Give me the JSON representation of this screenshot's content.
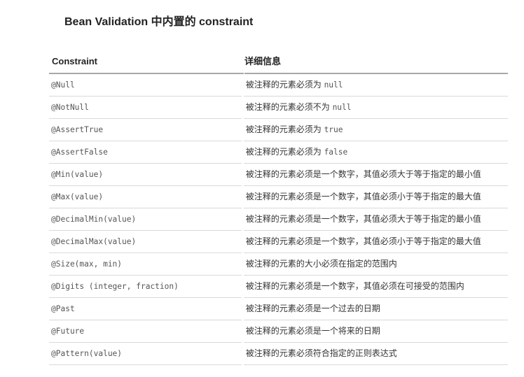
{
  "title": "Bean Validation 中内置的 constraint",
  "table": {
    "headers": [
      "Constraint",
      "详细信息"
    ],
    "rows": [
      {
        "constraint": "@Null",
        "desc": "被注释的元素必须为 ",
        "code": "null",
        "tail": ""
      },
      {
        "constraint": "@NotNull",
        "desc": "被注释的元素必须不为 ",
        "code": "null",
        "tail": ""
      },
      {
        "constraint": "@AssertTrue",
        "desc": "被注释的元素必须为 ",
        "code": "true",
        "tail": ""
      },
      {
        "constraint": "@AssertFalse",
        "desc": "被注释的元素必须为 ",
        "code": "false",
        "tail": ""
      },
      {
        "constraint": "@Min(value)",
        "desc": "被注释的元素必须是一个数字，其值必须大于等于指定的最小值",
        "code": "",
        "tail": ""
      },
      {
        "constraint": "@Max(value)",
        "desc": "被注释的元素必须是一个数字，其值必须小于等于指定的最大值",
        "code": "",
        "tail": ""
      },
      {
        "constraint": "@DecimalMin(value)",
        "desc": "被注释的元素必须是一个数字，其值必须大于等于指定的最小值",
        "code": "",
        "tail": ""
      },
      {
        "constraint": "@DecimalMax(value)",
        "desc": "被注释的元素必须是一个数字，其值必须小于等于指定的最大值",
        "code": "",
        "tail": ""
      },
      {
        "constraint": "@Size(max, min)",
        "desc": "被注释的元素的大小必须在指定的范围内",
        "code": "",
        "tail": ""
      },
      {
        "constraint": "@Digits (integer, fraction)",
        "desc": "被注释的元素必须是一个数字，其值必须在可接受的范围内",
        "code": "",
        "tail": ""
      },
      {
        "constraint": "@Past",
        "desc": "被注释的元素必须是一个过去的日期",
        "code": "",
        "tail": ""
      },
      {
        "constraint": "@Future",
        "desc": "被注释的元素必须是一个将来的日期",
        "code": "",
        "tail": ""
      },
      {
        "constraint": "@Pattern(value)",
        "desc": "被注释的元素必须符合指定的正则表达式",
        "code": "",
        "tail": ""
      }
    ]
  }
}
